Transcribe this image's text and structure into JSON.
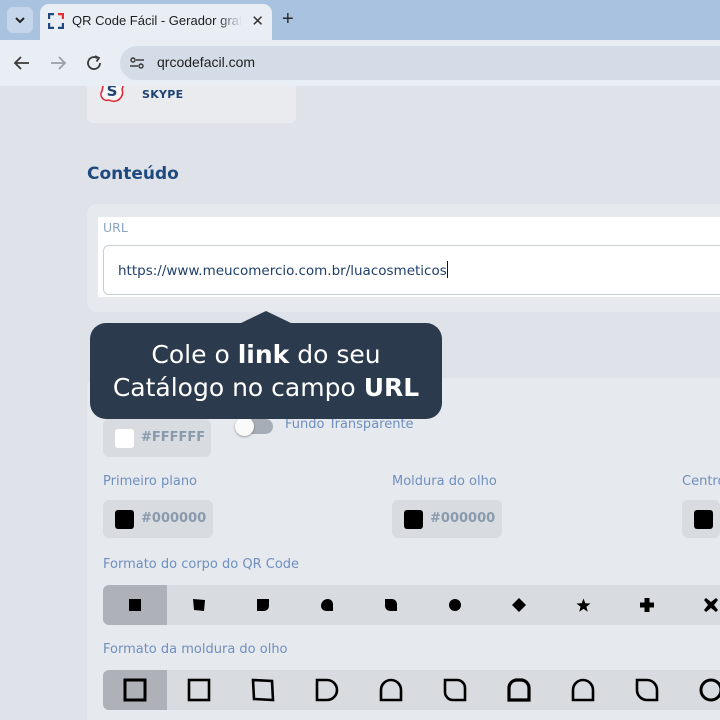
{
  "browser": {
    "tab_title": "QR Code Fácil - Gerador gratuito",
    "close_glyph": "✕",
    "new_tab_glyph": "+",
    "url": "qrcodefacil.com"
  },
  "page": {
    "skype_label": "SKYPE",
    "content_title": "Conteúdo",
    "url_label": "URL",
    "url_value": "https://www.meucomercio.com.br/luacosmeticos",
    "background": {
      "color_value": "#FFFFFF",
      "transparent_label": "Fundo Transparente"
    },
    "foreground_label": "Primeiro plano",
    "foreground_value": "#000000",
    "eye_frame_label": "Moldura do olho",
    "eye_frame_value": "#000000",
    "center_label": "Centro",
    "body_shape_label": "Formato do corpo do QR Code",
    "eye_frame_shape_label": "Formato da moldura do olho"
  },
  "tooltip": {
    "line1_pre": "Cole o ",
    "line1_bold": "link",
    "line1_post": " do seu",
    "line2_pre": "Catálogo no campo ",
    "line2_bold": "URL"
  },
  "colors": {
    "accent": "#1e4a7f",
    "tooltip_bg": "#2b3a4c",
    "label": "#6f8fbf"
  }
}
